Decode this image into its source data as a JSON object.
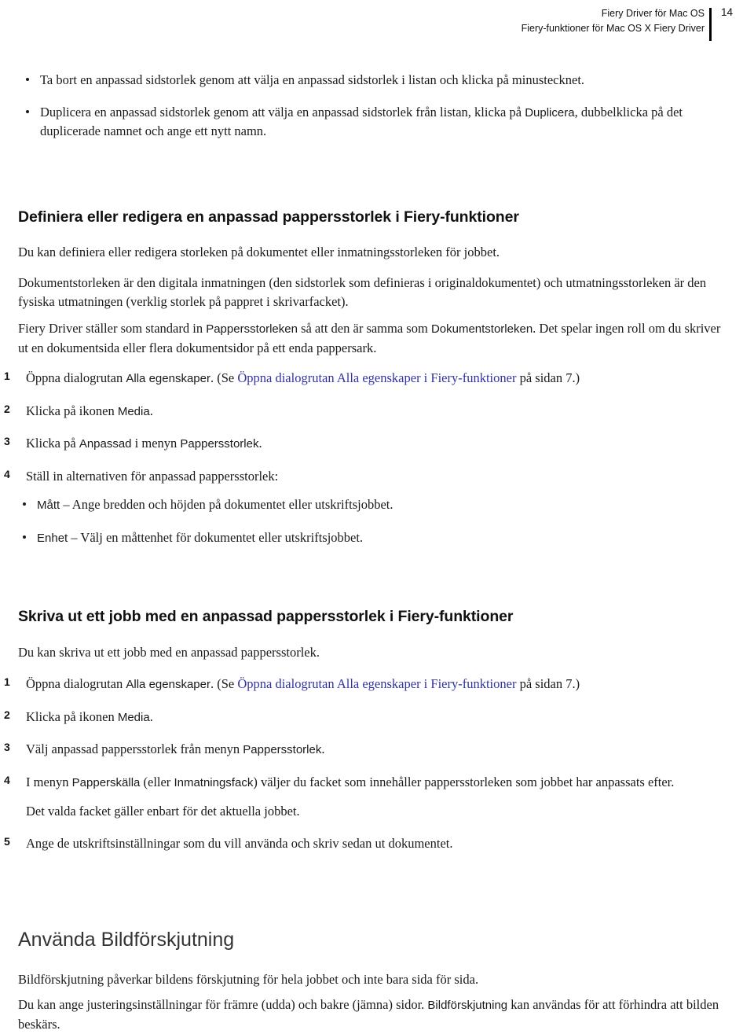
{
  "header": {
    "title_line1": "Fiery Driver för Mac OS",
    "title_line2": "Fiery-funktioner för Mac OS X Fiery Driver",
    "page_number": "14"
  },
  "top_bullets": [
    {
      "text_1": "Ta bort en anpassad sidstorlek genom att välja en anpassad sidstorlek i listan och klicka på minustecknet."
    },
    {
      "text_1": "Duplicera en anpassad sidstorlek genom att välja en anpassad sidstorlek från listan, klicka på ",
      "ui_1": "Duplicera",
      "text_2": ", dubbelklicka på det duplicerade namnet och ange ett nytt namn."
    }
  ],
  "section1": {
    "heading": "Definiera eller redigera en anpassad pappersstorlek i Fiery-funktioner",
    "intro": "Du kan definiera eller redigera storleken på dokumentet eller inmatningsstorleken för jobbet.",
    "para2": "Dokumentstorleken är den digitala inmatningen (den sidstorlek som definieras i originaldokumentet) och utmatningsstorleken är den fysiska utmatningen (verklig storlek på pappret i skrivarfacket).",
    "para3_a": "Fiery Driver ställer som standard in ",
    "para3_ui1": "Pappersstorleken",
    "para3_b": " så att den är samma som ",
    "para3_ui2": "Dokumentstorleken",
    "para3_c": ". Det spelar ingen roll om du skriver ut en dokumentsida eller flera dokumentsidor på ett enda pappersark.",
    "steps": [
      {
        "num": "1",
        "text_a": "Öppna dialogrutan ",
        "ui_1": "Alla egenskaper",
        "text_b": ". (Se ",
        "link": "Öppna dialogrutan Alla egenskaper i Fiery-funktioner",
        "text_c": " på sidan 7.)"
      },
      {
        "num": "2",
        "text_a": "Klicka på ikonen ",
        "ui_1": "Media",
        "text_b": "."
      },
      {
        "num": "3",
        "text_a": "Klicka på ",
        "ui_1": "Anpassad",
        "text_b": " i menyn ",
        "ui_2": "Pappersstorlek",
        "text_c": "."
      },
      {
        "num": "4",
        "text_a": "Ställ in alternativen för anpassad pappersstorlek:"
      }
    ],
    "sub_bullets": [
      {
        "ui_1": "Mått",
        "text_1": " – Ange bredden och höjden på dokumentet eller utskriftsjobbet."
      },
      {
        "ui_1": "Enhet",
        "text_1": " – Välj en måttenhet för dokumentet eller utskriftsjobbet."
      }
    ]
  },
  "section2": {
    "heading": "Skriva ut ett jobb med en anpassad pappersstorlek i Fiery-funktioner",
    "intro": "Du kan skriva ut ett jobb med en anpassad pappersstorlek.",
    "steps": [
      {
        "num": "1",
        "text_a": "Öppna dialogrutan ",
        "ui_1": "Alla egenskaper",
        "text_b": ". (Se ",
        "link": "Öppna dialogrutan Alla egenskaper i Fiery-funktioner",
        "text_c": " på sidan 7.)"
      },
      {
        "num": "2",
        "text_a": "Klicka på ikonen ",
        "ui_1": "Media",
        "text_b": "."
      },
      {
        "num": "3",
        "text_a": "Välj anpassad pappersstorlek från menyn ",
        "ui_1": "Pappersstorlek",
        "text_b": "."
      },
      {
        "num": "4",
        "text_a": "I menyn ",
        "ui_1": "Papperskälla",
        "text_b": " (eller ",
        "ui_2": "Inmatningsfack",
        "text_c": ") väljer du facket som innehåller pappersstorleken som jobbet har anpassats efter."
      },
      {
        "num": "5",
        "text_a": "Ange de utskriftsinställningar som du vill använda och skriv sedan ut dokumentet."
      }
    ],
    "note": "Det valda facket gäller enbart för det aktuella jobbet."
  },
  "section3": {
    "heading": "Använda Bildförskjutning",
    "para1": "Bildförskjutning påverkar bildens förskjutning för hela jobbet och inte bara sida för sida.",
    "para2_a": "Du kan ange justeringsinställningar för främre (udda) och bakre (jämna) sidor. ",
    "para2_ui1": "Bildförskjutning",
    "para2_b": " kan användas för att förhindra att bilden beskärs."
  },
  "colors": {
    "link": "#3232a0",
    "text": "#1a1a1a",
    "rule": "#000000"
  }
}
